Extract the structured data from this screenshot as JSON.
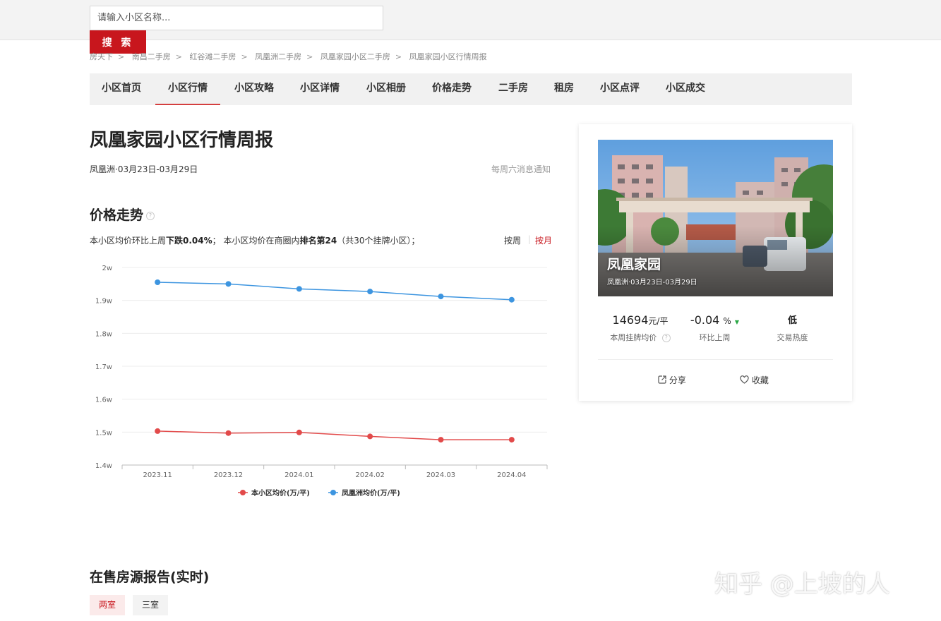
{
  "search": {
    "placeholder": "请输入小区名称...",
    "button_label": "搜 索"
  },
  "breadcrumb": [
    "房天下",
    "南昌二手房",
    "红谷滩二手房",
    "凤凰洲二手房",
    "凤凰家园小区二手房",
    "凤凰家园小区行情周报"
  ],
  "nav": {
    "items": [
      "小区首页",
      "小区行情",
      "小区攻略",
      "小区详情",
      "小区相册",
      "价格走势",
      "二手房",
      "租房",
      "小区点评",
      "小区成交"
    ],
    "active_index": 1
  },
  "report": {
    "title": "凤凰家园小区行情周报",
    "period": "凤凰洲·03月23日-03月29日",
    "notify": "每周六消息通知"
  },
  "price_trend": {
    "title": "价格走势",
    "help_icon": "question-circle-icon",
    "summary_1": "本小区均价环比上周",
    "summary_2": "下跌0.04%",
    "summary_3": "；  本小区均价在商圈内",
    "summary_4": "排名第24",
    "summary_5": "（共30个挂牌小区）；",
    "toggle_week": "按周",
    "toggle_month": "按月",
    "toggle_active": "按月"
  },
  "chart_data": {
    "type": "line",
    "categories": [
      "2023.11",
      "2023.12",
      "2024.01",
      "2024.02",
      "2024.03",
      "2024.04"
    ],
    "y_tick_labels": [
      "1.4w",
      "1.5w",
      "1.6w",
      "1.7w",
      "1.8w",
      "1.9w",
      "2w"
    ],
    "ylim": [
      1.4,
      2.0
    ],
    "y_unit": "万/平",
    "grid": true,
    "legend_position": "bottom",
    "series": [
      {
        "name": "本小区均价(万/平)",
        "color": "#e24a4a",
        "values": [
          1.503,
          1.497,
          1.499,
          1.487,
          1.477,
          1.477
        ]
      },
      {
        "name": "凤凰洲均价(万/平)",
        "color": "#3d95e0",
        "values": [
          1.955,
          1.95,
          1.935,
          1.927,
          1.912,
          1.902
        ]
      }
    ]
  },
  "for_sale": {
    "title": "在售房源报告(实时)",
    "tabs": [
      "两室",
      "三室"
    ],
    "active_index": 0
  },
  "card": {
    "photo_title": "凤凰家园",
    "photo_subtitle": "凤凰洲·03月23日-03月29日",
    "listing_price_value": "14694",
    "listing_price_unit": "元/平",
    "listing_price_label": "本周挂牌均价",
    "change_value": "-0.04",
    "change_unit": "%",
    "change_label": "环比上周",
    "heat_value": "低",
    "heat_label": "交易热度",
    "share_label": "分享",
    "favorite_label": "收藏",
    "share_icon": "share-icon",
    "favorite_icon": "heart-icon"
  },
  "watermark": "知乎 @上坡的人",
  "colors": {
    "accent": "#c8161d",
    "nav_bg": "#f1f1f1",
    "down": "#27a744"
  }
}
